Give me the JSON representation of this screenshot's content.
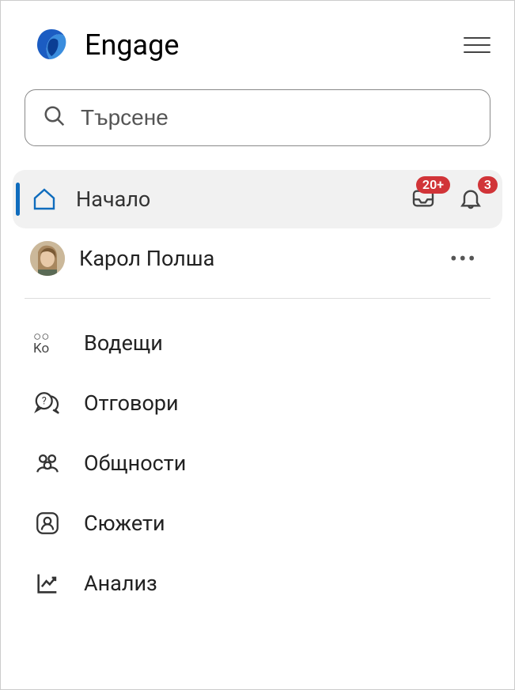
{
  "header": {
    "app_name": "Engage"
  },
  "search": {
    "placeholder": "Търсене"
  },
  "nav": {
    "home": {
      "label": "Начало"
    },
    "inbox_badge": "20+",
    "notifications_badge": "3"
  },
  "user": {
    "name": "Карол  Полша"
  },
  "menu": {
    "leaders": {
      "label": "Водещи"
    },
    "answers": {
      "label": "Отговори"
    },
    "communities": {
      "label": "Общности"
    },
    "storylines": {
      "label": "Сюжети"
    },
    "analytics": {
      "label": "Анализ"
    }
  }
}
